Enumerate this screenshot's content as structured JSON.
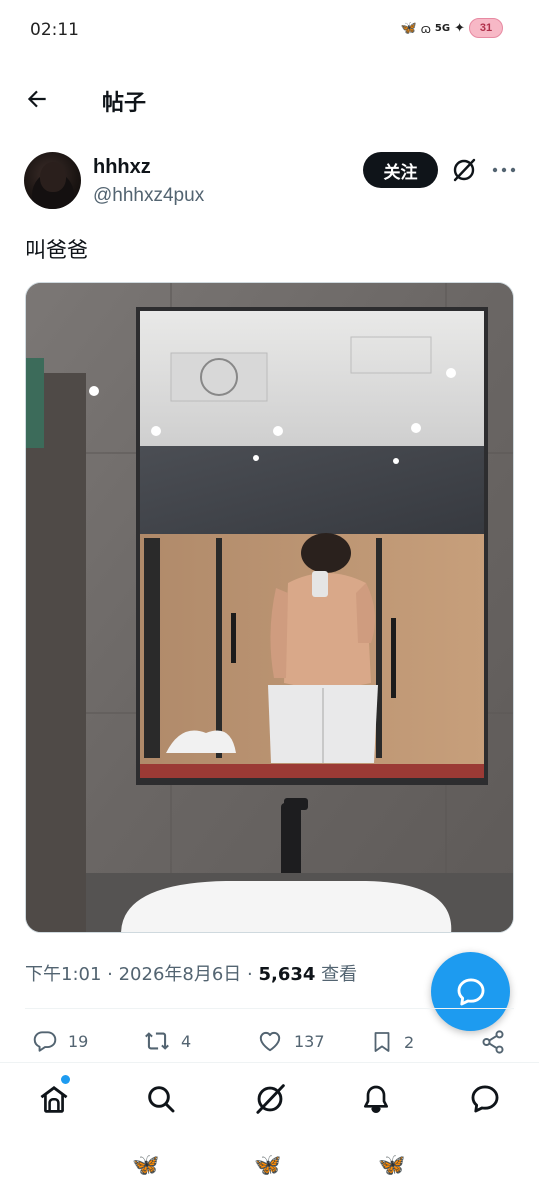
{
  "status_bar": {
    "time": "02:11",
    "network": "5G",
    "battery": "31"
  },
  "header": {
    "title": "帖子"
  },
  "author": {
    "display_name": "hhhxz",
    "handle": "@hhhxz4pux",
    "follow_label": "关注"
  },
  "post": {
    "text": "叫爸爸",
    "media_icon": "mirror-selfie-photo"
  },
  "meta": {
    "datetime": "下午1:01 · 2026年8月6日 · ",
    "views_count": "5,634",
    "views_label": " 查看"
  },
  "actions": {
    "replies": "19",
    "reposts": "4",
    "likes": "137",
    "bookmarks": "2"
  },
  "bottom_nav": {
    "items": [
      "home-icon",
      "search-icon",
      "grok-icon",
      "notifications-icon",
      "messages-icon"
    ]
  },
  "colors": {
    "accent": "#1d9bf0",
    "text": "#0f1419",
    "muted": "#536471"
  }
}
